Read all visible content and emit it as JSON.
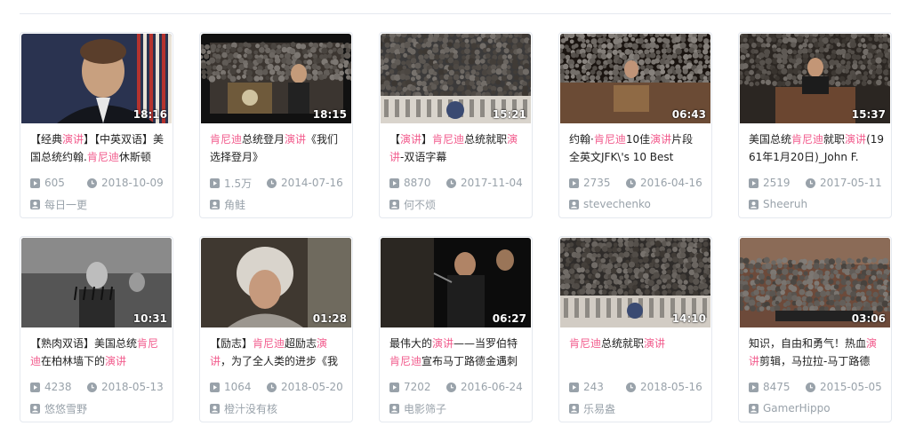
{
  "colors": {
    "highlight": "#f25d8e",
    "meta": "#99a2aa",
    "border": "#e5e9ef"
  },
  "icons": {
    "play": "play-count-icon",
    "time": "clock-icon",
    "user": "user-icon"
  },
  "videos": [
    {
      "duration": "18:16",
      "title": [
        [
          "【经典",
          ""
        ],
        [
          "演讲",
          "hl"
        ],
        [
          "】【中英双语】美国总统约翰.",
          ""
        ],
        [
          "肯尼迪",
          "hl"
        ],
        [
          "休斯顿",
          ""
        ]
      ],
      "plays": "605",
      "date": "2018-10-09",
      "author": "每日一更"
    },
    {
      "duration": "18:15",
      "title": [
        [
          "肯尼迪",
          "hl"
        ],
        [
          "总统登月",
          ""
        ],
        [
          "演讲",
          "hl"
        ],
        [
          "《我们选择登月》",
          ""
        ]
      ],
      "plays": "1.5万",
      "date": "2014-07-16",
      "author": "角鲑"
    },
    {
      "duration": "15:21",
      "title": [
        [
          "【",
          ""
        ],
        [
          "演讲",
          "hl"
        ],
        [
          "】",
          ""
        ],
        [
          "肯尼迪",
          "hl"
        ],
        [
          "总统就职",
          ""
        ],
        [
          "演讲",
          "hl"
        ],
        [
          "-双语字幕",
          ""
        ]
      ],
      "plays": "8870",
      "date": "2017-11-04",
      "author": "何不烦"
    },
    {
      "duration": "06:43",
      "title": [
        [
          "约翰·",
          ""
        ],
        [
          "肯尼迪",
          "hl"
        ],
        [
          "10佳",
          ""
        ],
        [
          "演讲",
          "hl"
        ],
        [
          "片段 全英文JFK\\'s 10 Best",
          ""
        ]
      ],
      "plays": "2735",
      "date": "2016-04-16",
      "author": "stevechenko"
    },
    {
      "duration": "15:37",
      "title": [
        [
          "美国总统",
          ""
        ],
        [
          "肯尼迪",
          "hl"
        ],
        [
          "就职",
          ""
        ],
        [
          "演讲",
          "hl"
        ],
        [
          "(1961年1月20日)_John F.",
          ""
        ]
      ],
      "plays": "2519",
      "date": "2017-05-11",
      "author": "Sheeruh"
    },
    {
      "duration": "10:31",
      "title": [
        [
          "【熟肉双语】美国总统",
          ""
        ],
        [
          "肯尼迪",
          "hl"
        ],
        [
          "在柏林墙下的",
          ""
        ],
        [
          "演讲",
          "hl"
        ]
      ],
      "plays": "4238",
      "date": "2018-05-13",
      "author": "悠悠雪野"
    },
    {
      "duration": "01:28",
      "title": [
        [
          "【励志】",
          ""
        ],
        [
          "肯尼迪",
          "hl"
        ],
        [
          "超励志",
          ""
        ],
        [
          "演讲",
          "hl"
        ],
        [
          "，为了全人类的进步《我",
          ""
        ]
      ],
      "plays": "1064",
      "date": "2018-05-20",
      "author": "橙汁没有核"
    },
    {
      "duration": "06:27",
      "title": [
        [
          "最伟大的",
          ""
        ],
        [
          "演讲",
          "hl"
        ],
        [
          "——当罗伯特",
          ""
        ],
        [
          "肯尼迪",
          "hl"
        ],
        [
          "宣布马丁路德金遇刺",
          ""
        ]
      ],
      "plays": "7202",
      "date": "2016-06-24",
      "author": "电影筛子"
    },
    {
      "duration": "14:10",
      "title": [
        [
          "肯尼迪",
          "hl"
        ],
        [
          "总统就职",
          ""
        ],
        [
          "演讲",
          "hl"
        ]
      ],
      "plays": "243",
      "date": "2018-05-16",
      "author": "乐易盎"
    },
    {
      "duration": "03:06",
      "title": [
        [
          "知识，自由和勇气！热血",
          ""
        ],
        [
          "演讲",
          "hl"
        ],
        [
          "剪辑，马拉拉-马丁路德",
          ""
        ]
      ],
      "plays": "8475",
      "date": "2015-05-05",
      "author": "GamerHippo"
    }
  ]
}
